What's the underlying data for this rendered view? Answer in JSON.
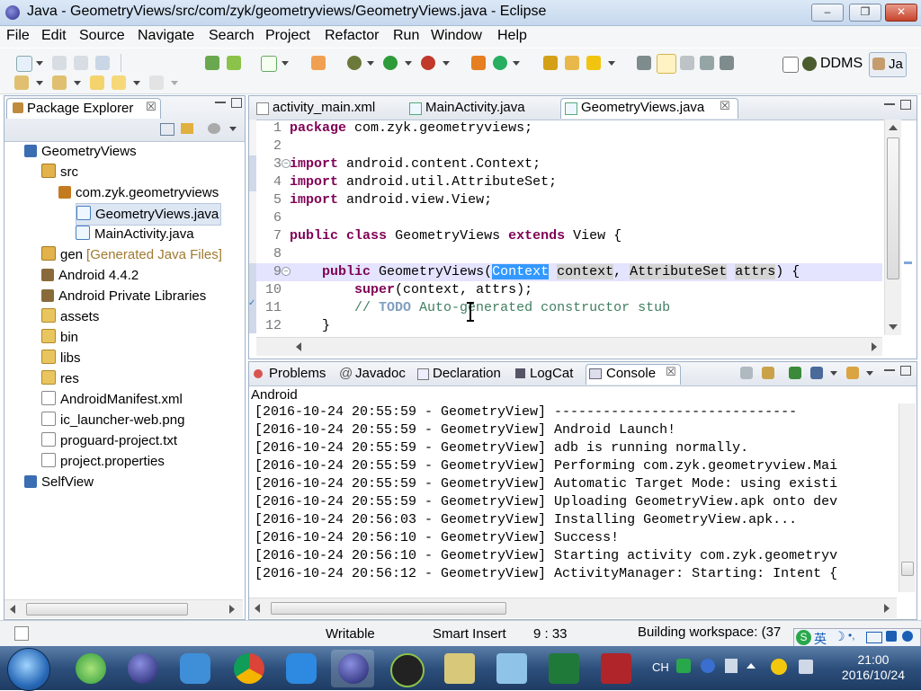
{
  "window": {
    "title": "Java - GeometryViews/src/com/zyk/geometryviews/GeometryViews.java - Eclipse",
    "controls": {
      "minimize": "–",
      "restore": "❐",
      "close": "✕"
    }
  },
  "menubar": [
    "File",
    "Edit",
    "Source",
    "Navigate",
    "Search",
    "Project",
    "Refactor",
    "Run",
    "Window",
    "Help"
  ],
  "toolbar": {
    "perspective_label": "DDMS",
    "java_perspective_label": "Ja"
  },
  "package_explorer": {
    "tab_label": "Package Explorer",
    "close_glyph": "☒",
    "items": [
      {
        "label": "GeometryViews",
        "indent": 0,
        "icon": "project-icon"
      },
      {
        "label": "src",
        "indent": 1,
        "icon": "source-folder-icon"
      },
      {
        "label": "com.zyk.geometryviews",
        "indent": 2,
        "icon": "package-icon"
      },
      {
        "label": "GeometryViews.java",
        "indent": 3,
        "icon": "java-file-icon",
        "selected": true
      },
      {
        "label": "MainActivity.java",
        "indent": 3,
        "icon": "java-file-icon"
      },
      {
        "label": "gen",
        "suffix": "[Generated Java Files]",
        "indent": 1,
        "icon": "source-folder-icon"
      },
      {
        "label": "Android 4.4.2",
        "indent": 1,
        "icon": "library-icon"
      },
      {
        "label": "Android Private Libraries",
        "indent": 1,
        "icon": "library-icon"
      },
      {
        "label": "assets",
        "indent": 1,
        "icon": "folder-icon"
      },
      {
        "label": "bin",
        "indent": 1,
        "icon": "folder-icon"
      },
      {
        "label": "libs",
        "indent": 1,
        "icon": "folder-icon"
      },
      {
        "label": "res",
        "indent": 1,
        "icon": "folder-icon"
      },
      {
        "label": "AndroidManifest.xml",
        "indent": 1,
        "icon": "xml-file-icon"
      },
      {
        "label": "ic_launcher-web.png",
        "indent": 1,
        "icon": "image-file-icon"
      },
      {
        "label": "proguard-project.txt",
        "indent": 1,
        "icon": "text-file-icon"
      },
      {
        "label": "project.properties",
        "indent": 1,
        "icon": "text-file-icon"
      },
      {
        "label": "SelfView",
        "indent": 0,
        "icon": "project-icon"
      }
    ]
  },
  "editor": {
    "tabs": [
      {
        "label": "activity_main.xml",
        "active": false
      },
      {
        "label": "MainActivity.java",
        "active": false
      },
      {
        "label": "GeometryViews.java",
        "active": true
      }
    ],
    "lines": [
      {
        "n": "1",
        "text": "package com.zyk.geometryviews;"
      },
      {
        "n": "2",
        "text": ""
      },
      {
        "n": "3",
        "text": "import android.content.Context;"
      },
      {
        "n": "4",
        "text": "import android.util.AttributeSet;"
      },
      {
        "n": "5",
        "text": "import android.view.View;"
      },
      {
        "n": "6",
        "text": ""
      },
      {
        "n": "7",
        "text": "public class GeometryViews extends View {"
      },
      {
        "n": "8",
        "text": ""
      },
      {
        "n": "9",
        "text": "    public GeometryViews(Context context, AttributeSet attrs) {"
      },
      {
        "n": "10",
        "text": "        super(context, attrs);"
      },
      {
        "n": "11",
        "text": "        // TODO Auto-generated constructor stub"
      },
      {
        "n": "12",
        "text": "    }"
      }
    ],
    "selected_word": "Context"
  },
  "bottom_panel": {
    "tabs": [
      {
        "label": "Problems",
        "active": false
      },
      {
        "label": "Javadoc",
        "active": false
      },
      {
        "label": "Declaration",
        "active": false
      },
      {
        "label": "LogCat",
        "active": false
      },
      {
        "label": "Console",
        "active": true
      }
    ],
    "console_name": "Android",
    "log_lines": [
      "[2016-10-24 20:55:59 - GeometryView] ------------------------------",
      "[2016-10-24 20:55:59 - GeometryView] Android Launch!",
      "[2016-10-24 20:55:59 - GeometryView] adb is running normally.",
      "[2016-10-24 20:55:59 - GeometryView] Performing com.zyk.geometryview.Mai",
      "[2016-10-24 20:55:59 - GeometryView] Automatic Target Mode: using existi",
      "[2016-10-24 20:55:59 - GeometryView] Uploading GeometryView.apk onto dev",
      "[2016-10-24 20:56:03 - GeometryView] Installing GeometryView.apk...",
      "[2016-10-24 20:56:10 - GeometryView] Success!",
      "[2016-10-24 20:56:10 - GeometryView] Starting activity com.zyk.geometryv",
      "[2016-10-24 20:56:12 - GeometryView] ActivityManager: Starting: Intent {"
    ]
  },
  "statusbar": {
    "writable": "Writable",
    "insert_mode": "Smart Insert",
    "position": "9 : 33",
    "progress": "Building workspace: (37"
  },
  "taskbar": {
    "tray_lang": "CH",
    "ime_label": "英",
    "time": "21:00",
    "date": "2016/10/24"
  },
  "colors": {
    "keyword": "#7f0055",
    "comment": "#3f7f5f",
    "selection": "#3399ff",
    "taskbar": "#2d4f7c"
  }
}
